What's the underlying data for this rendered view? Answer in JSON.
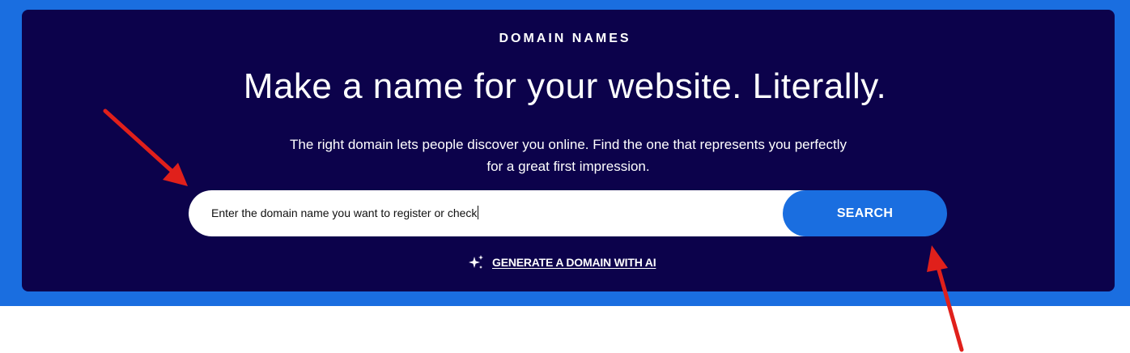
{
  "hero": {
    "eyebrow": "DOMAIN NAMES",
    "headline": "Make a name for your website. Literally.",
    "subtext": "The right domain lets people discover you online. Find the one that represents you perfectly for a great first impression."
  },
  "search": {
    "value": "Enter the domain name you want to register or check",
    "button_label": "SEARCH"
  },
  "ai_link": {
    "icon": "sparkles-icon",
    "label": "GENERATE A DOMAIN WITH AI"
  },
  "colors": {
    "band_blue": "#1a6ee0",
    "card_navy": "#0c024b",
    "annotation_red": "#e0201b"
  },
  "annotations": {
    "arrows": [
      "arrow pointing to search input",
      "arrow pointing to search button"
    ]
  }
}
